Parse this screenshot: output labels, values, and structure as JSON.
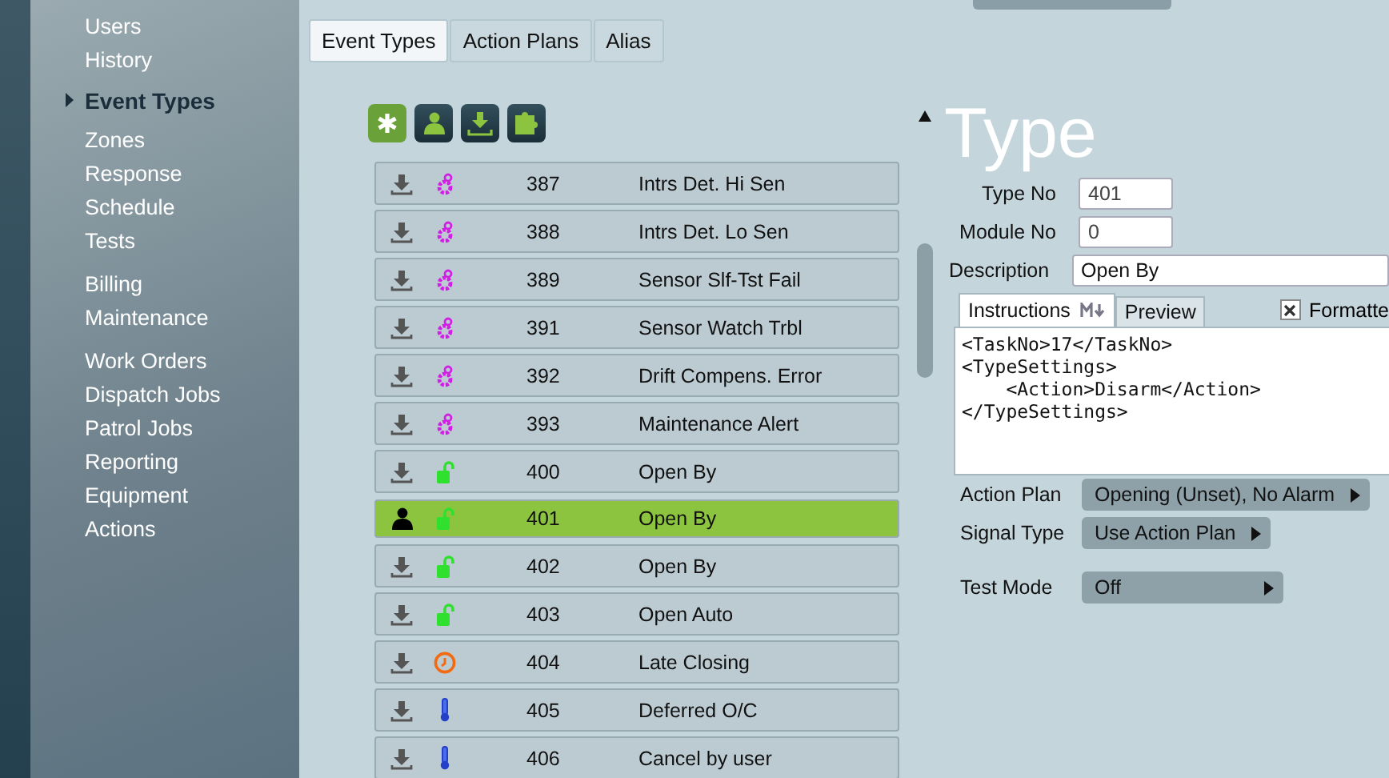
{
  "sidebar": {
    "groups": [
      {
        "items": [
          {
            "label": "Users",
            "selected": false
          },
          {
            "label": "History",
            "selected": false
          },
          {
            "label": "Event Types",
            "selected": true
          },
          {
            "label": "Zones",
            "selected": false
          },
          {
            "label": "Response",
            "selected": false
          },
          {
            "label": "Schedule",
            "selected": false
          },
          {
            "label": "Tests",
            "selected": false
          }
        ]
      },
      {
        "items": [
          {
            "label": "Billing",
            "selected": false
          },
          {
            "label": "Maintenance",
            "selected": false
          }
        ]
      },
      {
        "items": [
          {
            "label": "Work Orders",
            "selected": false
          },
          {
            "label": "Dispatch Jobs",
            "selected": false
          },
          {
            "label": "Patrol Jobs",
            "selected": false
          },
          {
            "label": "Reporting",
            "selected": false
          },
          {
            "label": "Equipment",
            "selected": false
          },
          {
            "label": "Actions",
            "selected": false
          }
        ]
      }
    ]
  },
  "tabs": [
    {
      "label": "Event Types",
      "selected": true
    },
    {
      "label": "Action Plans",
      "selected": false
    },
    {
      "label": "Alias",
      "selected": false
    }
  ],
  "toolbar": [
    {
      "kind": "asterisk"
    },
    {
      "kind": "person"
    },
    {
      "kind": "download"
    },
    {
      "kind": "puzzle"
    }
  ],
  "event_types": [
    {
      "number": "387",
      "name": "Intrs Det. Hi Sen",
      "kind": "gear",
      "selected": false
    },
    {
      "number": "388",
      "name": "Intrs Det. Lo Sen",
      "kind": "gear",
      "selected": false
    },
    {
      "number": "389",
      "name": "Sensor Slf-Tst Fail",
      "kind": "gear",
      "selected": false
    },
    {
      "number": "391",
      "name": "Sensor Watch Trbl",
      "kind": "gear",
      "selected": false
    },
    {
      "number": "392",
      "name": "Drift Compens. Error",
      "kind": "gear",
      "selected": false
    },
    {
      "number": "393",
      "name": "Maintenance Alert",
      "kind": "gear",
      "selected": false
    },
    {
      "number": "400",
      "name": "Open By",
      "kind": "lock",
      "selected": false
    },
    {
      "number": "401",
      "name": "Open By",
      "kind": "lock",
      "selected": true
    },
    {
      "number": "402",
      "name": "Open By",
      "kind": "lock",
      "selected": false
    },
    {
      "number": "403",
      "name": "Open Auto",
      "kind": "lock",
      "selected": false
    },
    {
      "number": "404",
      "name": "Late Closing",
      "kind": "clock",
      "selected": false
    },
    {
      "number": "405",
      "name": "Deferred O/C",
      "kind": "thermometer",
      "selected": false
    },
    {
      "number": "406",
      "name": "Cancel by user",
      "kind": "thermometer",
      "selected": false
    }
  ],
  "form": {
    "heading": "Type",
    "fields": [
      {
        "label": "Type No",
        "value": "401",
        "kind": "short"
      },
      {
        "label": "Module No",
        "value": "0",
        "kind": "short"
      },
      {
        "label": "Description",
        "value": "Open By",
        "kind": "long"
      }
    ],
    "editor_tabs": [
      {
        "label": "Instructions",
        "selected": true
      },
      {
        "label": "Preview",
        "selected": false
      }
    ],
    "formatted": {
      "label": "Formatte",
      "checked": true
    },
    "instructions": "<TaskNo>17</TaskNo>\n<TypeSettings>\n    <Action>Disarm</Action>\n</TypeSettings>",
    "selects": [
      {
        "label": "Action Plan",
        "value": "Opening (Unset), No Alarm"
      },
      {
        "label": "Signal Type",
        "value": "Use Action Plan"
      },
      {
        "label": "Test Mode",
        "value": "Off"
      }
    ]
  }
}
